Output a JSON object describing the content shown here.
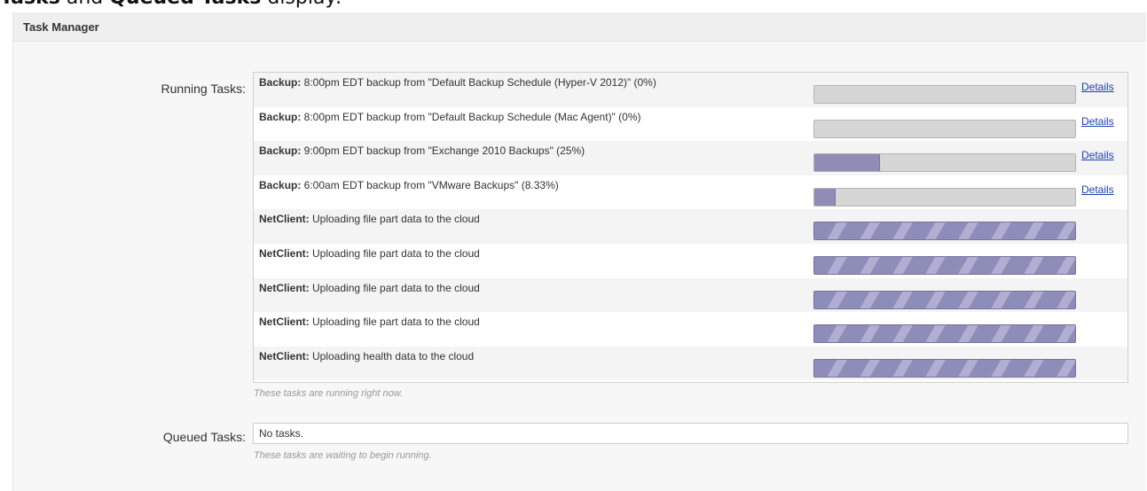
{
  "doc_snippet": {
    "bold_1": "Tasks",
    "plain": " and ",
    "bold_2": "Queued Tasks",
    "tail": " display:"
  },
  "panel": {
    "title": "Task Manager"
  },
  "running": {
    "label": "Running Tasks:",
    "hint": "These tasks are running right now.",
    "details_label": "Details",
    "tasks": [
      {
        "type": "Backup:",
        "text": " 8:00pm EDT backup from \"Default Backup Schedule (Hyper-V 2012)\" (0%)",
        "progress": 0,
        "has_details": true
      },
      {
        "type": "Backup:",
        "text": " 8:00pm EDT backup from \"Default Backup Schedule (Mac Agent)\" (0%)",
        "progress": 0,
        "has_details": true
      },
      {
        "type": "Backup:",
        "text": " 9:00pm EDT backup from \"Exchange 2010 Backups\" (25%)",
        "progress": 25,
        "has_details": true
      },
      {
        "type": "Backup:",
        "text": " 6:00am EDT backup from \"VMware Backups\" (8.33%)",
        "progress": 8.33,
        "has_details": true
      },
      {
        "type": "NetClient:",
        "text": " Uploading file part data to the cloud",
        "progress": null,
        "has_details": false
      },
      {
        "type": "NetClient:",
        "text": " Uploading file part data to the cloud",
        "progress": null,
        "has_details": false
      },
      {
        "type": "NetClient:",
        "text": " Uploading file part data to the cloud",
        "progress": null,
        "has_details": false
      },
      {
        "type": "NetClient:",
        "text": " Uploading file part data to the cloud",
        "progress": null,
        "has_details": false
      },
      {
        "type": "NetClient:",
        "text": " Uploading health data to the cloud",
        "progress": null,
        "has_details": false
      }
    ]
  },
  "queued": {
    "label": "Queued Tasks:",
    "value": "No tasks.",
    "hint": "These tasks are waiting to begin running."
  }
}
